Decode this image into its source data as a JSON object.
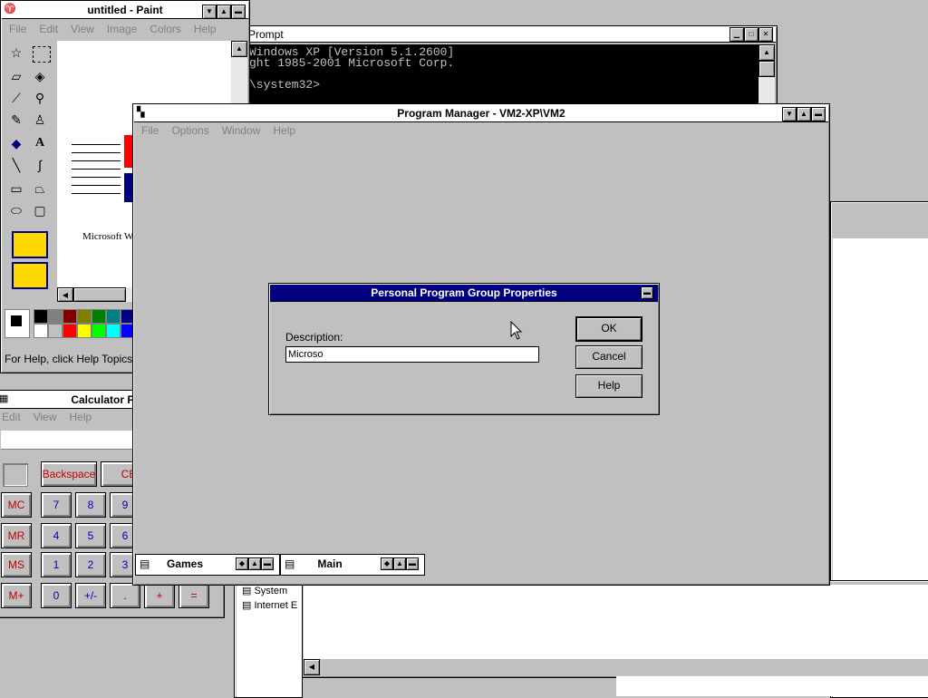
{
  "paint": {
    "title": "untitled - Paint",
    "menu": [
      "File",
      "Edit",
      "View",
      "Image",
      "Colors",
      "Help"
    ],
    "status": "For Help, click Help Topics",
    "canvas_text": "Microsoft Wo",
    "palette": [
      "#000000",
      "#808080",
      "#800000",
      "#808000",
      "#008000",
      "#008080",
      "#000080",
      "#ffffff",
      "#c0c0c0",
      "#ff0000",
      "#ffff00",
      "#00ff00",
      "#00ffff",
      "#0000ff"
    ]
  },
  "cmd": {
    "title": "Prompt",
    "lines": [
      "Windows XP [Version 5.1.2600]",
      "ght 1985-2001 Microsoft Corp.",
      "",
      "\\system32>"
    ]
  },
  "calculator": {
    "title": "Calculator Plus",
    "menu": [
      "Edit",
      "View",
      "Help"
    ],
    "buttons": {
      "backspace": "Backspace",
      "ce": "CE",
      "mc": "MC",
      "mr": "MR",
      "ms": "MS",
      "mplus": "M+",
      "n7": "7",
      "n8": "8",
      "n9": "9",
      "n4": "4",
      "n5": "5",
      "n6": "6",
      "n1": "1",
      "n2": "2",
      "n3": "3",
      "n0": "0",
      "plusminus": "+/-",
      "dot": ".",
      "plus": "+",
      "equals": "="
    }
  },
  "explorer": {
    "items": [
      "System",
      "Internet E"
    ]
  },
  "progman": {
    "title": "Program Manager - VM2-XP\\VM2",
    "menu": [
      "File",
      "Options",
      "Window",
      "Help"
    ],
    "groups": [
      "Games",
      "Main"
    ]
  },
  "dialog": {
    "title": "Personal Program Group Properties",
    "description_label": "Description:",
    "description_value": "Microso",
    "ok": "OK",
    "cancel": "Cancel",
    "help": "Help"
  }
}
